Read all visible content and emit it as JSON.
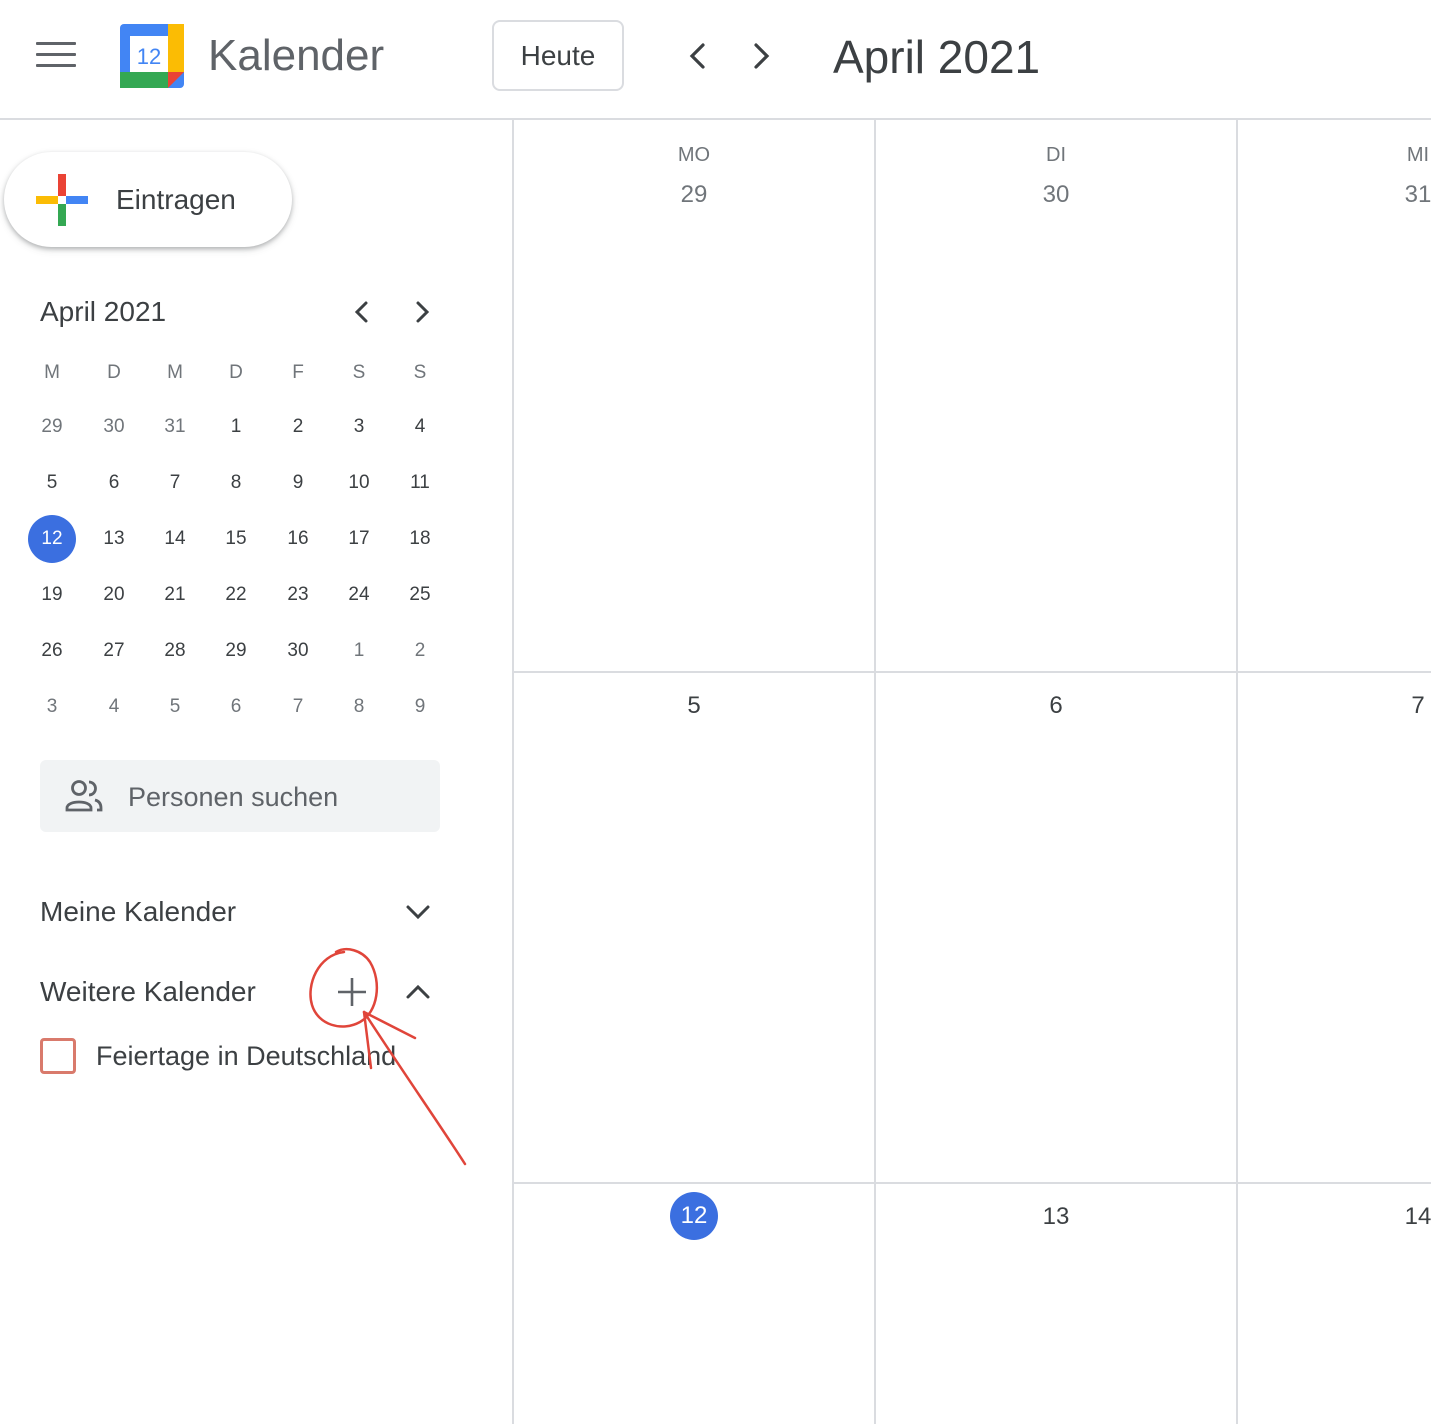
{
  "header": {
    "app_title": "Kalender",
    "logo_number": "12",
    "today_label": "Heute",
    "month_title": "April 2021"
  },
  "sidebar": {
    "create_label": "Eintragen",
    "mini_calendar": {
      "title": "April 2021",
      "weekday_headers": [
        "M",
        "D",
        "M",
        "D",
        "F",
        "S",
        "S"
      ],
      "weeks": [
        [
          "29",
          "30",
          "31",
          "1",
          "2",
          "3",
          "4"
        ],
        [
          "5",
          "6",
          "7",
          "8",
          "9",
          "10",
          "11"
        ],
        [
          "12",
          "13",
          "14",
          "15",
          "16",
          "17",
          "18"
        ],
        [
          "19",
          "20",
          "21",
          "22",
          "23",
          "24",
          "25"
        ],
        [
          "26",
          "27",
          "28",
          "29",
          "30",
          "1",
          "2"
        ],
        [
          "3",
          "4",
          "5",
          "6",
          "7",
          "8",
          "9"
        ]
      ]
    },
    "people_search_placeholder": "Personen suchen",
    "my_calendars_label": "Meine Kalender",
    "other_calendars_label": "Weitere Kalender",
    "other_calendars": [
      {
        "label": "Feiertage in Deutschland",
        "color": "#d97a6c",
        "checked": false
      }
    ]
  },
  "grid": {
    "columns": [
      {
        "dow": "MO",
        "date": "29"
      },
      {
        "dow": "DI",
        "date": "30"
      },
      {
        "dow": "MI",
        "date": "31"
      }
    ],
    "week2": [
      "5",
      "6",
      "7"
    ],
    "week3": [
      "12",
      "13",
      "14"
    ]
  },
  "colors": {
    "accent": "#3b6fe0",
    "annotation": "#e0453a",
    "divider": "#dadce0"
  }
}
